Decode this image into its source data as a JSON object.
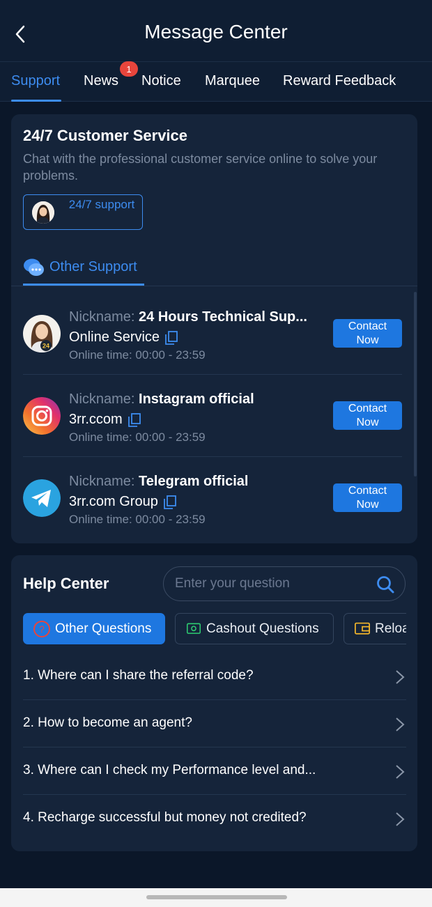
{
  "header": {
    "title": "Message Center",
    "back_icon": "chevron-left-icon"
  },
  "tabs": [
    {
      "label": "Support",
      "active": true
    },
    {
      "label": "News",
      "badge": "1"
    },
    {
      "label": "Notice"
    },
    {
      "label": "Marquee"
    },
    {
      "label": "Reward Feedback"
    }
  ],
  "customer_service": {
    "title": "24/7 Customer Service",
    "description": "Chat with the professional customer service online to solve your problems.",
    "support_button": "24/7 support",
    "other_support_label": "Other Support"
  },
  "contacts": [
    {
      "nickname_label": "Nickname: ",
      "nickname": "24 Hours Technical Sup...",
      "service": "Online Service",
      "online_time": "Online time: 00:00 - 23:59",
      "button": "Contact Now",
      "avatar": "agent-avatar"
    },
    {
      "nickname_label": "Nickname: ",
      "nickname": "Instagram official",
      "service": "3rr.ccom",
      "online_time": "Online time: 00:00 - 23:59",
      "button": "Contact Now",
      "avatar": "instagram-icon"
    },
    {
      "nickname_label": "Nickname: ",
      "nickname": "Telegram official",
      "service": "3rr.com Group",
      "online_time": "Online time: 00:00 - 23:59",
      "button": "Contact Now",
      "avatar": "telegram-icon"
    }
  ],
  "help_center": {
    "title": "Help Center",
    "search_placeholder": "Enter your question",
    "categories": [
      {
        "label": "Other Questions",
        "active": true,
        "icon": "question-circle-icon"
      },
      {
        "label": "Cashout Questions",
        "icon": "cash-icon"
      },
      {
        "label": "Reloa",
        "icon": "wallet-icon"
      }
    ],
    "faqs": [
      "1. Where can I share the referral code?",
      "2. How to become an agent?",
      "3. Where can I check my Performance level and...",
      "4. Recharge successful but money not credited?"
    ]
  },
  "colors": {
    "background": "#0b1729",
    "card": "#15243a",
    "accent": "#3d8cf0",
    "button": "#1e77e0",
    "badge": "#e8453c"
  }
}
